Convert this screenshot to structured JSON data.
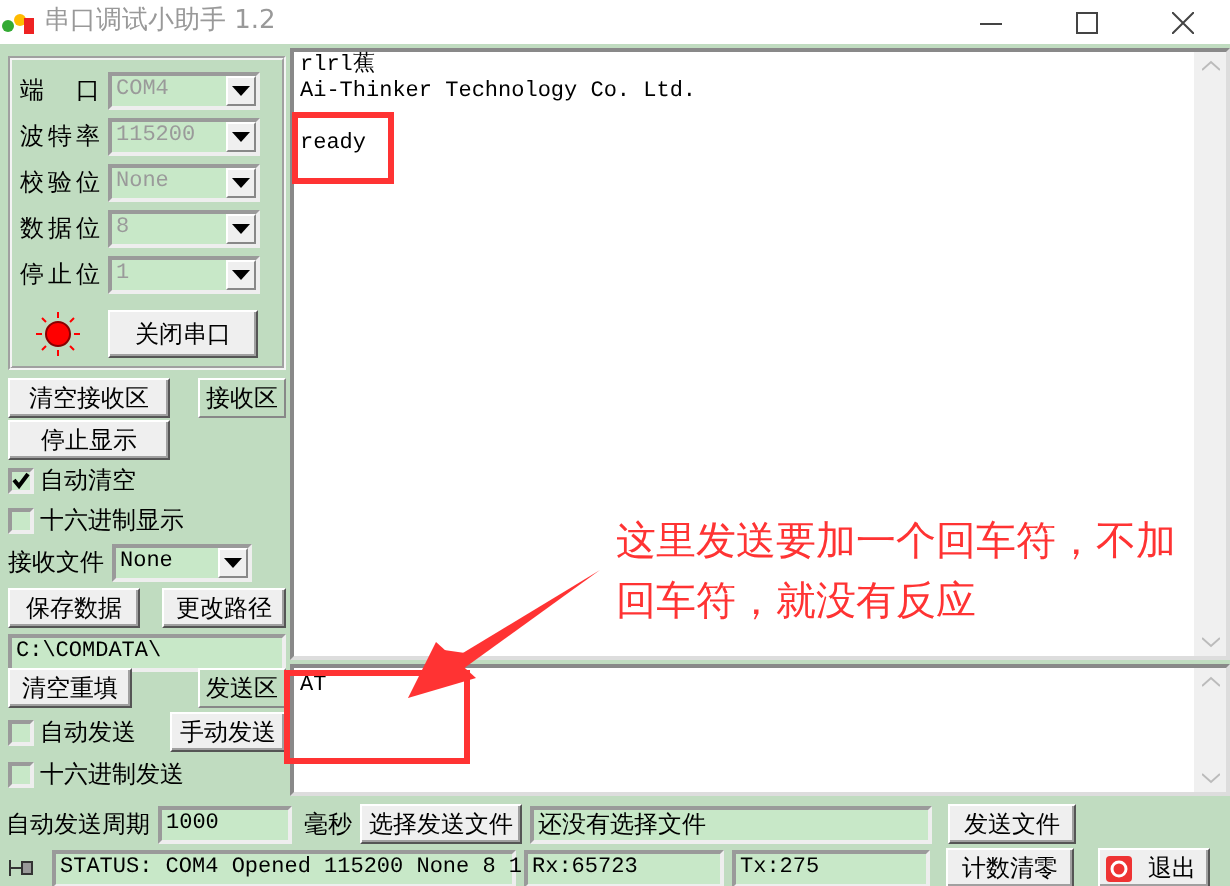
{
  "window": {
    "title": "串口调试小助手 1.2"
  },
  "port_settings": [
    {
      "label": "端 口",
      "value": "COM4",
      "disabled": true
    },
    {
      "label": "波特率",
      "value": "115200",
      "disabled": true
    },
    {
      "label": "校验位",
      "value": "None",
      "disabled": true
    },
    {
      "label": "数据位",
      "value": "8",
      "disabled": true
    },
    {
      "label": "停止位",
      "value": "1",
      "disabled": true
    }
  ],
  "port_open": true,
  "open_close_button": "关闭串口",
  "receive": {
    "clear_button": "清空接收区",
    "area_label": "接收区",
    "stop_button": "停止显示",
    "options": [
      {
        "label": "自动清空",
        "checked": true
      },
      {
        "label": "十六进制显示",
        "checked": false
      }
    ],
    "file_label": "接收文件",
    "file_value": "None",
    "save_button": "保存数据",
    "path_button": "更改路径",
    "path": "C:\\COMDATA\\"
  },
  "received_lines": [
    {
      "text": "rlrl蕉"
    },
    {
      "text": "Ai-Thinker Technology Co. Ltd.",
      "blank_after": true
    },
    {
      "text": "ready"
    }
  ],
  "send": {
    "clear_button": "清空重填",
    "area_label": "发送区",
    "options": [
      {
        "label": "自动发送",
        "checked": false
      },
      {
        "label": "十六进制发送",
        "checked": false
      }
    ],
    "manual_button": "手动发送",
    "text": "AT",
    "period_label": "自动发送周期",
    "period_value": "1000",
    "period_unit": "毫秒",
    "choose_file_button": "选择发送文件",
    "file_field": "还没有选择文件",
    "send_file_button": "发送文件"
  },
  "status_bar": {
    "status": "STATUS: COM4 Opened 115200 None 8 1",
    "rx": "Rx:65723",
    "tx": "Tx:275",
    "reset_button": "计数清零",
    "exit_button": "退出"
  },
  "annotation": {
    "text": "这里发送要加一个回车符，不加回车符，就没有反应"
  }
}
